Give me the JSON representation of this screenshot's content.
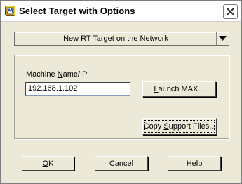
{
  "window": {
    "title": "Select Target with Options",
    "app_icon": "labview-icon",
    "close_icon": "close-icon"
  },
  "target_select": {
    "value": "New RT Target on the Network",
    "arrow_icon": "triangle-down-icon"
  },
  "machine": {
    "label_pre": "Machine ",
    "label_mnemonic": "N",
    "label_post": "ame/IP",
    "value": "192.168.1.102"
  },
  "buttons": {
    "launch_mnemonic": "L",
    "launch_rest": "aunch MAX...",
    "copy_pre": "Copy ",
    "copy_mnemonic": "S",
    "copy_post": "upport Files...",
    "ok_mnemonic": "O",
    "ok_rest": "K",
    "cancel": "Cancel",
    "help": "Help"
  }
}
